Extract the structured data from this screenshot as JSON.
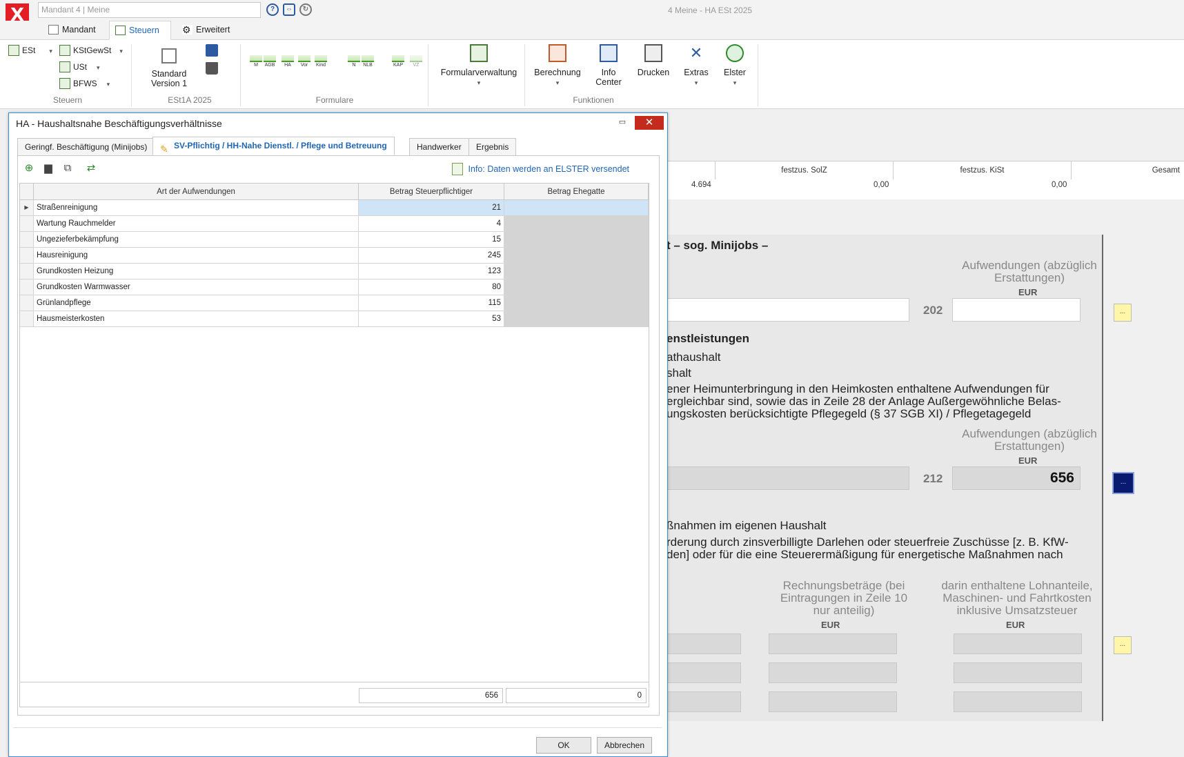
{
  "app": {
    "logo": "X",
    "quick_box": "Mandant 4  |  Meine",
    "window_title": "4 Meine -  HA ESt 2025"
  },
  "ribbon_tabs": [
    "Mandant",
    "Steuern",
    "Erweitert"
  ],
  "ribbon": {
    "steuern_group": {
      "items": [
        "ESt",
        "KStGewSt",
        "USt",
        "BFWS"
      ],
      "label": "Steuern"
    },
    "version_group": {
      "button": "Standard Version 1",
      "label": "ESt1A 2025"
    },
    "formulare_group": {
      "minis": [
        "M",
        "AGB",
        "HA",
        "Vor",
        "Kind",
        "N",
        "NLB",
        "KAP",
        "VZ"
      ],
      "label": "Formulare"
    },
    "formularverwaltung": "Formularverwaltung",
    "funktionen_group": {
      "items": [
        "Berechnung",
        "Info Center",
        "Drucken",
        "Extras",
        "Elster"
      ],
      "label": "Funktionen"
    }
  },
  "background": {
    "table_headers": [
      "festzus. SolZ",
      "festzus. KiSt",
      "Gesamt"
    ],
    "table_values": [
      "4.694",
      "0,00",
      "0,00"
    ],
    "form": {
      "heading1": "t – sog. Minijobs –",
      "col_head": "Aufwendungen (abzüglich Erstattungen)",
      "eur": "EUR",
      "line202": "202",
      "heading2": "enstleistungen",
      "text_a": "athaushalt",
      "text_b": "shalt",
      "text_c1": "ener Heimunterbringung in den Heimkosten enthaltene Aufwendungen für",
      "text_c2": "ergleichbar sind, sowie das in Zeile 28 der Anlage Außergewöhnliche Belas-",
      "text_c3": "ungskosten berücksichtigte Pflegegeld (§ 37 SGB XI) / Pflegetagegeld",
      "line212": "212",
      "value212": "656",
      "text_d1": "ßnahmen im eigenen Haushalt",
      "text_d2": "rderung durch zinsverbilligte Darlehen oder steuerfreie Zuschüsse [z. B. KfW-",
      "text_d3": "den] oder für die eine Steuerermäßigung für energetische Maßnahmen nach",
      "col_rechnung": "Rechnungsbeträge (bei Eintragungen in Zeile 10 nur anteilig)",
      "col_lohn": "darin enthaltene Lohnanteile, Maschinen- und Fahrtkosten inklusive Umsatzsteuer",
      "dots": "..."
    }
  },
  "dialog": {
    "title": "HA - Haushaltsnahe Beschäftigungsverhältnisse",
    "close": "✕",
    "tabs": [
      "Geringf. Beschäftigung (Minijobs)",
      "SV-Pflichtig / HH-Nahe Dienstl. / Pflege und Betreuung",
      "Handwerker",
      "Ergebnis"
    ],
    "info": "Info: Daten werden an ELSTER versendet",
    "columns": [
      "Art der Aufwendungen",
      "Betrag Steuerpflichtiger",
      "Betrag Ehegatte"
    ],
    "rows": [
      {
        "name": "Straßenreinigung",
        "value": "21"
      },
      {
        "name": "Wartung Rauchmelder",
        "value": "4"
      },
      {
        "name": "Ungezieferbekämpfung",
        "value": "15"
      },
      {
        "name": "Hausreinigung",
        "value": "245"
      },
      {
        "name": "Grundkosten Heizung",
        "value": "123"
      },
      {
        "name": "Grundkosten Warmwasser",
        "value": "80"
      },
      {
        "name": "Grünlandpflege",
        "value": "115"
      },
      {
        "name": "Hausmeisterkosten",
        "value": "53"
      }
    ],
    "sum_taxpayer": "656",
    "sum_spouse": "0",
    "ok": "OK",
    "cancel": "Abbrechen"
  },
  "colors": {
    "accent": "#2166b5",
    "logo_red": "#e31e24",
    "close_red": "#c42b1c",
    "selected_row": "#cfe4f7"
  }
}
